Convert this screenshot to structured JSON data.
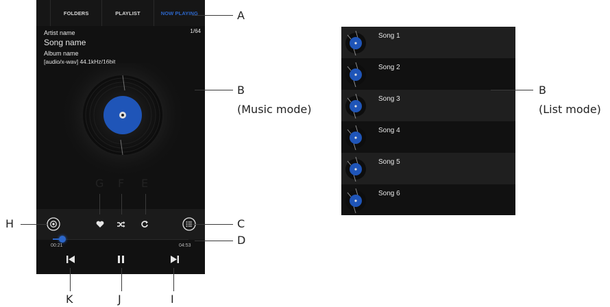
{
  "tabs": [
    {
      "label": "FOLDERS",
      "active": false
    },
    {
      "label": "PLAYLIST",
      "active": false
    },
    {
      "label": "NOW PLAYING",
      "active": true
    }
  ],
  "track": {
    "artist": "Artist name",
    "song": "Song name",
    "album": "Album name",
    "format": "[audio/x-wav] 44.1kHz/16bit",
    "counter": "1/64"
  },
  "playback": {
    "elapsed": "00:21",
    "duration": "04:53",
    "progress_fraction": 0.07
  },
  "icons": {
    "settings": "gear-icon",
    "favorite": "heart-icon",
    "shuffle": "shuffle-icon",
    "repeat": "repeat-icon",
    "list": "list-icon",
    "previous": "skip-previous-icon",
    "pause": "pause-icon",
    "next": "skip-next-icon",
    "disc": "vinyl-disc-icon"
  },
  "callouts": {
    "A": "A",
    "B_music": "B",
    "B_music_sub": "(Music mode)",
    "B_list": "B",
    "B_list_sub": "(List mode)",
    "C": "C",
    "D": "D",
    "E": "E",
    "F": "F",
    "G": "G",
    "H": "H",
    "I": "I",
    "J": "J",
    "K": "K"
  },
  "list": {
    "songs": [
      "Song 1",
      "Song 2",
      "Song 3",
      "Song 4",
      "Song 5",
      "Song 6"
    ]
  },
  "colors": {
    "accent": "#2c66c9",
    "background": "#111111",
    "controls_bar": "#1b1b1b",
    "list_alt_row": "#1f1f1f"
  }
}
